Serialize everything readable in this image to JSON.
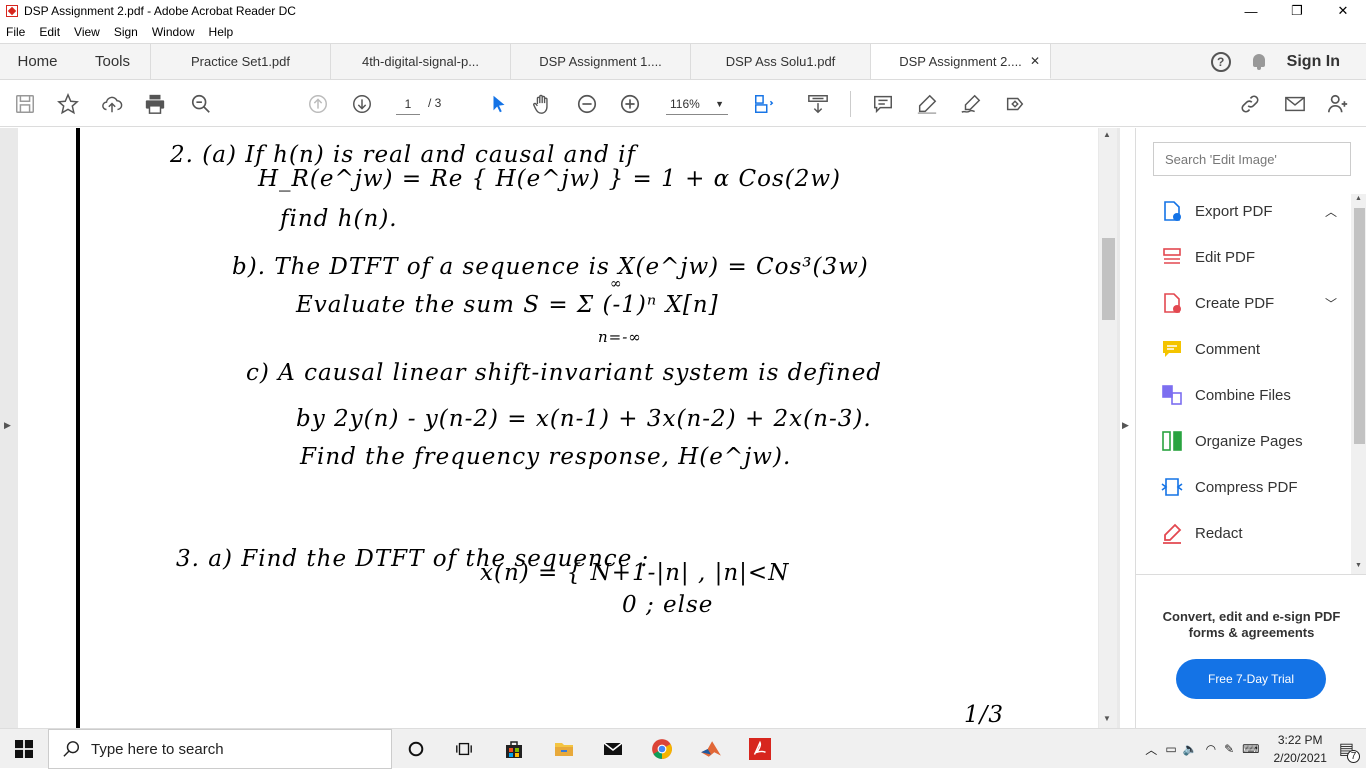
{
  "window": {
    "title": "DSP Assignment 2.pdf - Adobe Acrobat Reader DC",
    "minimize": "—",
    "restore": "❐",
    "close": "✕"
  },
  "menu": [
    "File",
    "Edit",
    "View",
    "Sign",
    "Window",
    "Help"
  ],
  "nav": {
    "home": "Home",
    "tools": "Tools",
    "sign_in": "Sign In",
    "help": "?"
  },
  "tabs": [
    {
      "label": "Practice Set1.pdf"
    },
    {
      "label": "4th-digital-signal-p..."
    },
    {
      "label": "DSP Assignment 1...."
    },
    {
      "label": "DSP Ass Solu1.pdf"
    },
    {
      "label": "DSP Assignment 2....",
      "active": true,
      "close": "✕"
    }
  ],
  "toolbar": {
    "page_current": "1",
    "page_total": "/ 3",
    "zoom": "116%"
  },
  "document": {
    "lines": [
      "2.  (a)  If  h(n)  is  real  and  causal  and  if",
      "H_R(e^jw) =  Re { H(e^jw) } = 1 + α Cos(2w)",
      "find  h(n).",
      "b).  The  DTFT  of  a  sequence  is   X(e^jw) = Cos³(3w)",
      "Evaluate  the  sum     S =  Σ (-1)ⁿ X[n]",
      "c)  A  causal  linear  shift-invariant  system  is  defined",
      "by      2y(n) - y(n-2)  =  x(n-1) + 3x(n-2) + 2x(n-3).",
      "Find  the  frequency  response,  H(e^jw).",
      "3.    a) Find   the  DTFT  of  the  sequence :",
      "x(n) =  {  N+1-|n| ,    |n|<N",
      "0          ;  else",
      "1/3"
    ],
    "sum_upper": "∞",
    "sum_lower": "n=-∞"
  },
  "right_panel": {
    "search_placeholder": "Search 'Edit Image'",
    "tools": [
      {
        "label": "Export PDF",
        "icon": "export-pdf-icon",
        "color": "#1473e6",
        "chevron": "up"
      },
      {
        "label": "Edit PDF",
        "icon": "edit-pdf-icon",
        "color": "#e34850"
      },
      {
        "label": "Create PDF",
        "icon": "create-pdf-icon",
        "color": "#e34850",
        "chevron": "down"
      },
      {
        "label": "Comment",
        "icon": "comment-icon",
        "color": "#f4c400"
      },
      {
        "label": "Combine Files",
        "icon": "combine-files-icon",
        "color": "#7c6ef0"
      },
      {
        "label": "Organize Pages",
        "icon": "organize-pages-icon",
        "color": "#2aa340"
      },
      {
        "label": "Compress PDF",
        "icon": "compress-pdf-icon",
        "color": "#1473e6"
      },
      {
        "label": "Redact",
        "icon": "redact-icon",
        "color": "#e34850"
      }
    ],
    "promo_text": "Convert, edit and e-sign PDF forms & agreements",
    "trial_button": "Free 7-Day Trial"
  },
  "taskbar": {
    "search_placeholder": "Type here to search",
    "time": "3:22 PM",
    "date": "2/20/2021",
    "notifications": "7"
  }
}
